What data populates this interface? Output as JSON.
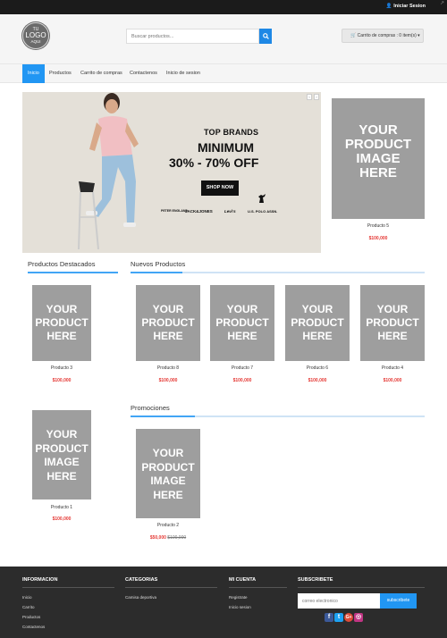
{
  "topbar": {
    "login_label": "Iniciar Sesion"
  },
  "header": {
    "logo": {
      "line1": "TU",
      "line2": "LOGO",
      "line3": "AQUI"
    },
    "search_placeholder": "Buscar productos...",
    "cart_label": "Carrito de compras : 0 item(s)"
  },
  "nav": [
    "Inicio",
    "Productos",
    "Carrito de compras",
    "Contactenos",
    "Inicio de sesion"
  ],
  "banner": {
    "line1": "TOP BRANDS",
    "line2": "MINIMUM",
    "line3": "30% - 70% OFF",
    "button": "SHOP NOW",
    "brands": [
      "PETER ENGLAND",
      "JACK&JONES",
      "Levi's",
      "U.S. POLO ASSN."
    ]
  },
  "placeholder_texts": {
    "image": "YOUR\nPRODUCT\nIMAGE\nHERE",
    "short": "YOUR\nPRODUCT\nHERE"
  },
  "side_product": {
    "name": "Producto 5",
    "price": "$100,000"
  },
  "sections": {
    "featured": "Productos Destacados",
    "new": "Nuevos Productos",
    "promo": "Promociones"
  },
  "featured_products": [
    {
      "name": "Producto 3",
      "price": "$100,000"
    },
    {
      "name": "Producto 1",
      "price": "$100,000"
    }
  ],
  "new_products": [
    {
      "name": "Producto 8",
      "price": "$100,000"
    },
    {
      "name": "Producto 7",
      "price": "$100,000"
    },
    {
      "name": "Producto 6",
      "price": "$100,000"
    },
    {
      "name": "Producto 4",
      "price": "$100,000"
    }
  ],
  "promo_product": {
    "name": "Producto 2",
    "price": "$50,000",
    "old_price": "$100,000"
  },
  "footer": {
    "info": {
      "title": "INFORMACION",
      "links": [
        "Inicio",
        "Carrito",
        "Productos",
        "Contactenos"
      ]
    },
    "categories": {
      "title": "CATEGORIAS",
      "links": [
        "Camisa deportiva"
      ]
    },
    "account": {
      "title": "MI CUENTA",
      "links": [
        "Registrate",
        "Inicio sesion"
      ]
    },
    "subscribe": {
      "title": "SUBSCRIBETE",
      "placeholder": "correo electronico",
      "button": "subscribete"
    }
  },
  "social": [
    {
      "icon": "facebook-icon",
      "glyph": "f",
      "color": "#3b5998"
    },
    {
      "icon": "twitter-icon",
      "glyph": "t",
      "color": "#1da1f2"
    },
    {
      "icon": "google-plus-icon",
      "glyph": "G+",
      "color": "#dd4b39"
    },
    {
      "icon": "instagram-icon",
      "glyph": "◎",
      "color": "#c13584"
    }
  ],
  "colors": {
    "accent": "#2196f3",
    "price": "#e53935",
    "placeholder": "#9e9e9e",
    "footer": "#2c2c2c"
  }
}
